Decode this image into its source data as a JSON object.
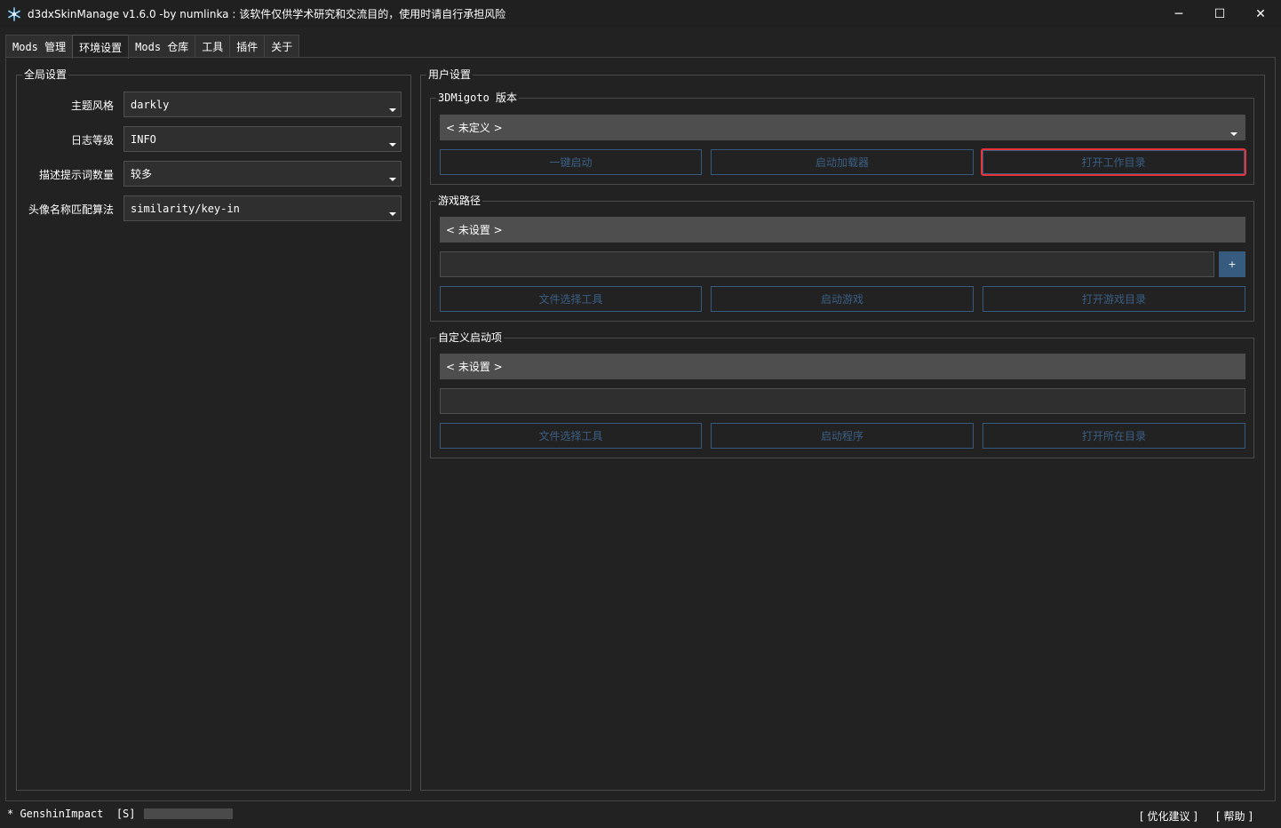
{
  "window": {
    "title": "d3dxSkinManage v1.6.0 -by numlinka : 该软件仅供学术研究和交流目的，使用时请自行承担风险",
    "icon": "snowflake-icon",
    "minimize_glyph": "─",
    "maximize_glyph": "☐",
    "close_glyph": "✕"
  },
  "tabs": [
    {
      "label": "Mods 管理",
      "active": false
    },
    {
      "label": "环境设置",
      "active": true
    },
    {
      "label": "Mods 仓库",
      "active": false
    },
    {
      "label": "工具",
      "active": false
    },
    {
      "label": "插件",
      "active": false
    },
    {
      "label": "关于",
      "active": false
    }
  ],
  "global_settings": {
    "title": "全局设置",
    "rows": [
      {
        "label": "主题风格",
        "value": "darkly"
      },
      {
        "label": "日志等级",
        "value": "INFO"
      },
      {
        "label": "描述提示词数量",
        "value": "较多"
      },
      {
        "label": "头像名称匹配算法",
        "value": "similarity/key-in"
      }
    ]
  },
  "user_settings": {
    "title": "用户设置",
    "migoto": {
      "title": "3DMigoto 版本",
      "selected": "< 未定义 >",
      "buttons": [
        "一键启动",
        "启动加载器",
        "打开工作目录"
      ]
    },
    "game_path": {
      "title": "游戏路径",
      "selected": "< 未设置 >",
      "path_value": "",
      "plus_label": "+",
      "buttons": [
        "文件选择工具",
        "启动游戏",
        "打开游戏目录"
      ]
    },
    "custom_launch": {
      "title": "自定义启动项",
      "selected": "< 未设置 >",
      "path_value": "",
      "buttons": [
        "文件选择工具",
        "启动程序",
        "打开所在目录"
      ]
    }
  },
  "status": {
    "left": "* GenshinImpact  [S]  -",
    "progress": 0,
    "suggest": "[ 优化建议 ]",
    "help": "[ 帮助 ]"
  },
  "colors": {
    "background": "#222222",
    "accent": "#375a7f",
    "highlight_border": "#e8333a"
  }
}
